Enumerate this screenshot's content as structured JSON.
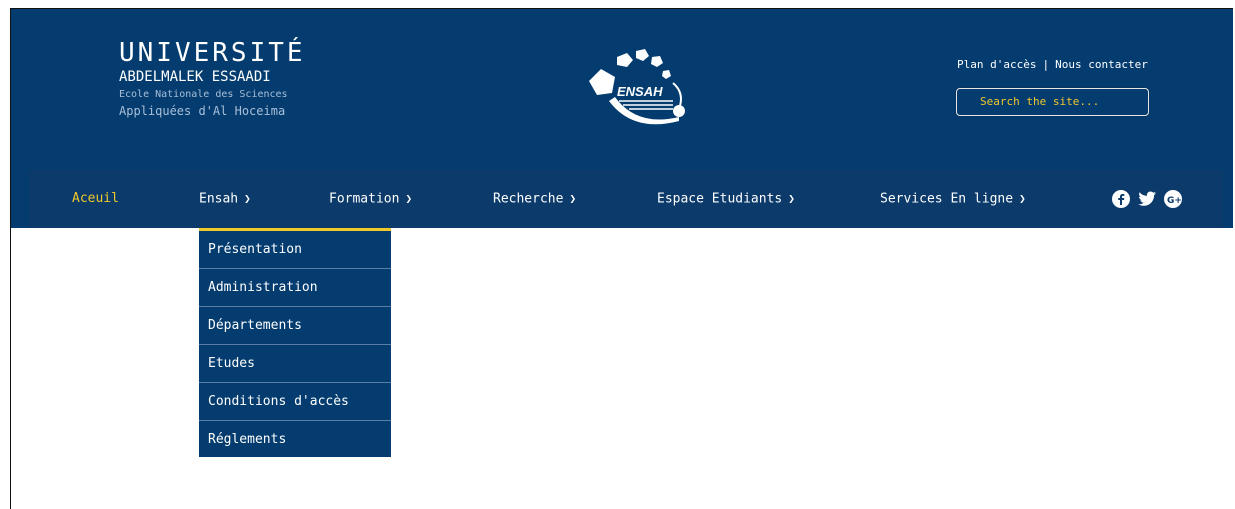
{
  "header": {
    "university": "UNIVERSITÉ",
    "subtitle": "ABDELMALEK ESSAADI",
    "school_line1": "Ecole Nationale des Sciences",
    "school_line2": "Appliquées d'Al Hoceima",
    "logo_text": "ENSAH",
    "links": {
      "plan": "Plan d'accès",
      "contact": "Nous contacter"
    },
    "search_placeholder": "Search the site..."
  },
  "nav": {
    "items": [
      {
        "label": "Aceuil",
        "active": true
      },
      {
        "label": "Ensah"
      },
      {
        "label": "Formation"
      },
      {
        "label": "Recherche"
      },
      {
        "label": "Espace Etudiants"
      },
      {
        "label": "Services En ligne"
      }
    ],
    "social": [
      "facebook-icon",
      "twitter-icon",
      "google-plus-icon"
    ]
  },
  "dropdown": {
    "items": [
      "Présentation",
      "Administration",
      "Départements",
      "Etudes",
      "Conditions d'accès",
      "Réglements"
    ]
  },
  "colors": {
    "header_bg": "#043c6f",
    "nav_bg": "#0b3a6b",
    "accent": "#f0c82a"
  }
}
